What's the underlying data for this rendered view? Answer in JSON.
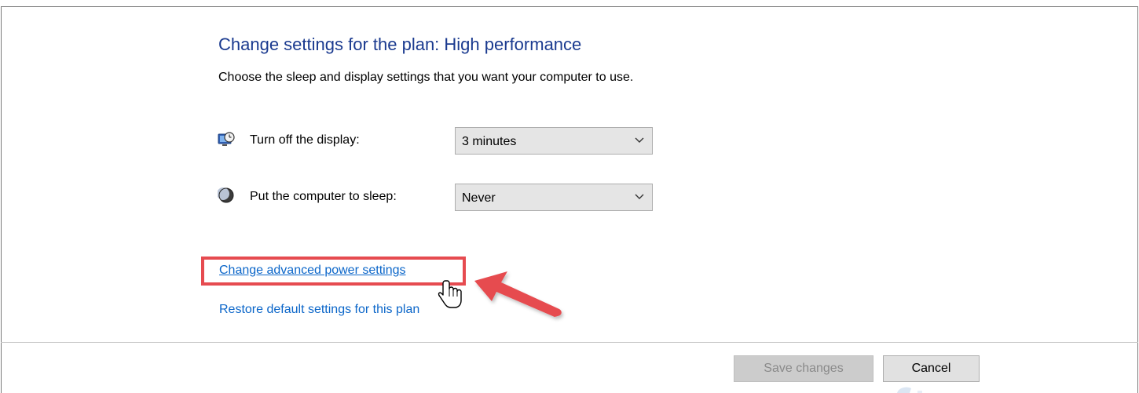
{
  "window": {
    "heading": "Change settings for the plan: High performance",
    "subheading": "Choose the sleep and display settings that you want your computer to use."
  },
  "settings": {
    "display": {
      "icon": "monitor-clock-icon",
      "label": "Turn off the display:",
      "value": "3 minutes"
    },
    "sleep": {
      "icon": "moon-icon",
      "label": "Put the computer to sleep:",
      "value": "Never"
    }
  },
  "links": {
    "advanced": "Change advanced power settings",
    "restore": "Restore default settings for this plan"
  },
  "buttons": {
    "save": "Save changes",
    "cancel": "Cancel"
  },
  "annotations": {
    "highlight_color": "#e64b50",
    "arrow_color": "#e64b50"
  },
  "colors": {
    "heading": "#1a3a8f",
    "link": "#0b66c9"
  }
}
